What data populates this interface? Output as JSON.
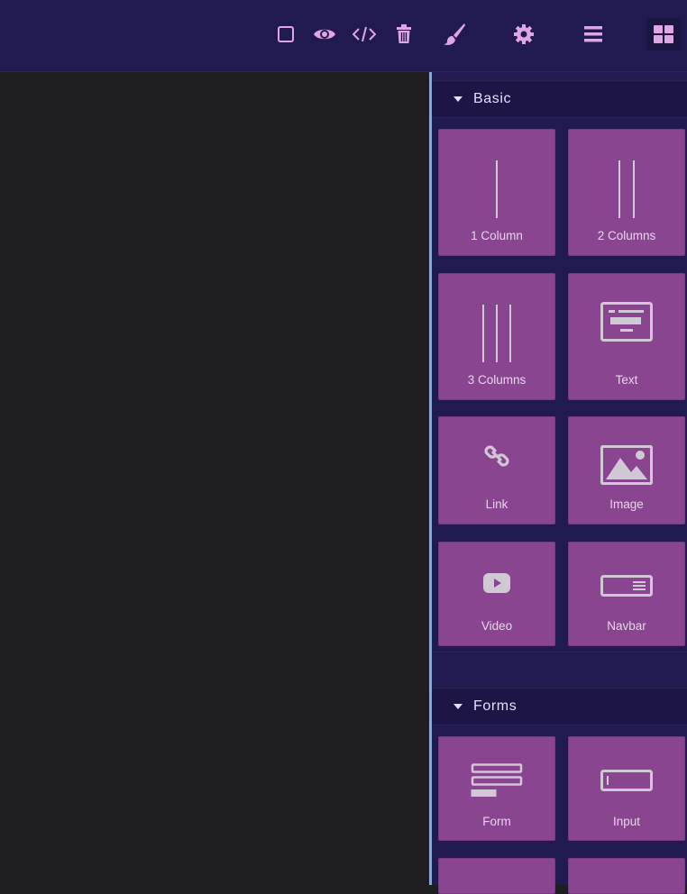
{
  "toolbar": {
    "buttons": [
      {
        "icon": "square-outline-icon"
      },
      {
        "icon": "eye-icon"
      },
      {
        "icon": "code-icon"
      },
      {
        "icon": "trash-icon"
      },
      {
        "icon": "paint-brush-icon"
      },
      {
        "icon": "gear-icon"
      },
      {
        "icon": "layers-icon"
      },
      {
        "icon": "blocks-grid-icon",
        "active": true
      }
    ]
  },
  "categories": [
    {
      "title": "Basic",
      "blocks": [
        {
          "label": "1 Column",
          "icon": "one-column-icon"
        },
        {
          "label": "2 Columns",
          "icon": "two-columns-icon"
        },
        {
          "label": "3 Columns",
          "icon": "three-columns-icon"
        },
        {
          "label": "Text",
          "icon": "text-icon"
        },
        {
          "label": "Link",
          "icon": "link-icon"
        },
        {
          "label": "Image",
          "icon": "image-icon"
        },
        {
          "label": "Video",
          "icon": "video-icon"
        },
        {
          "label": "Navbar",
          "icon": "navbar-icon"
        }
      ]
    },
    {
      "title": "Forms",
      "blocks": [
        {
          "label": "Form",
          "icon": "form-icon"
        },
        {
          "label": "Input",
          "icon": "input-icon"
        }
      ]
    }
  ],
  "colors": {
    "topbar": "#211a50",
    "panel": "#211a50",
    "block": "#8a4590",
    "icon_accent": "#e0a6e4",
    "canvas": "#1e1d22"
  }
}
